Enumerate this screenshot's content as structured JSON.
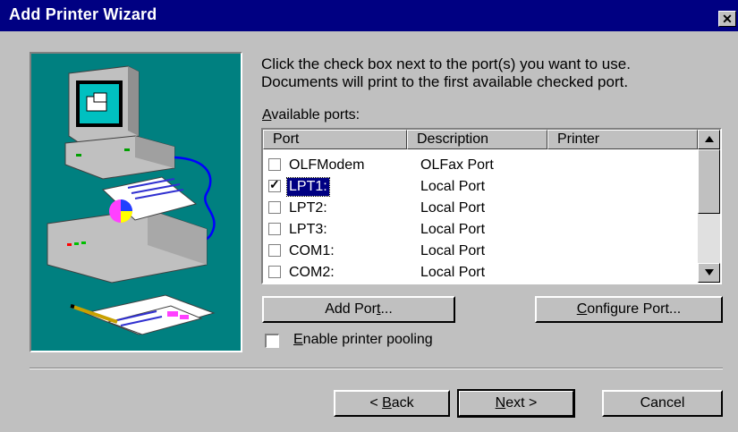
{
  "window": {
    "title": "Add Printer Wizard",
    "close_glyph": "✕"
  },
  "instructions": {
    "line1": "Click the check box next to the port(s) you want to use.",
    "line2": "Documents will print to the first available checked port."
  },
  "ports_label": {
    "accel": "A",
    "rest": "vailable ports:"
  },
  "columns": [
    "Port",
    "Description",
    "Printer"
  ],
  "ports": [
    {
      "name": "OLFModem",
      "description": "OLFax Port",
      "checked": false,
      "selected": false
    },
    {
      "name": "LPT1:",
      "description": "Local Port",
      "checked": true,
      "selected": true
    },
    {
      "name": "LPT2:",
      "description": "Local Port",
      "checked": false,
      "selected": false
    },
    {
      "name": "LPT3:",
      "description": "Local Port",
      "checked": false,
      "selected": false
    },
    {
      "name": "COM1:",
      "description": "Local Port",
      "checked": false,
      "selected": false
    },
    {
      "name": "COM2:",
      "description": "Local Port",
      "checked": false,
      "selected": false
    }
  ],
  "buttons": {
    "add_port": {
      "pre": "Add Por",
      "accel": "t",
      "post": "..."
    },
    "configure_port": {
      "pre": "",
      "accel": "C",
      "post": "onfigure Port..."
    },
    "back": {
      "pre": "< ",
      "accel": "B",
      "post": "ack"
    },
    "next": {
      "pre": "",
      "accel": "N",
      "post": "ext >"
    },
    "cancel": {
      "label": "Cancel"
    }
  },
  "pooling": {
    "accel": "E",
    "rest": "nable printer pooling",
    "checked": false
  },
  "colors": {
    "titlebar": "#000082",
    "art_bg": "#008080",
    "face": "#c0c0c0",
    "selection": "#000082"
  },
  "icons": [
    "close-icon",
    "computer-icon",
    "printer-icon",
    "documents-icon",
    "scroll-up-icon",
    "scroll-down-icon"
  ]
}
